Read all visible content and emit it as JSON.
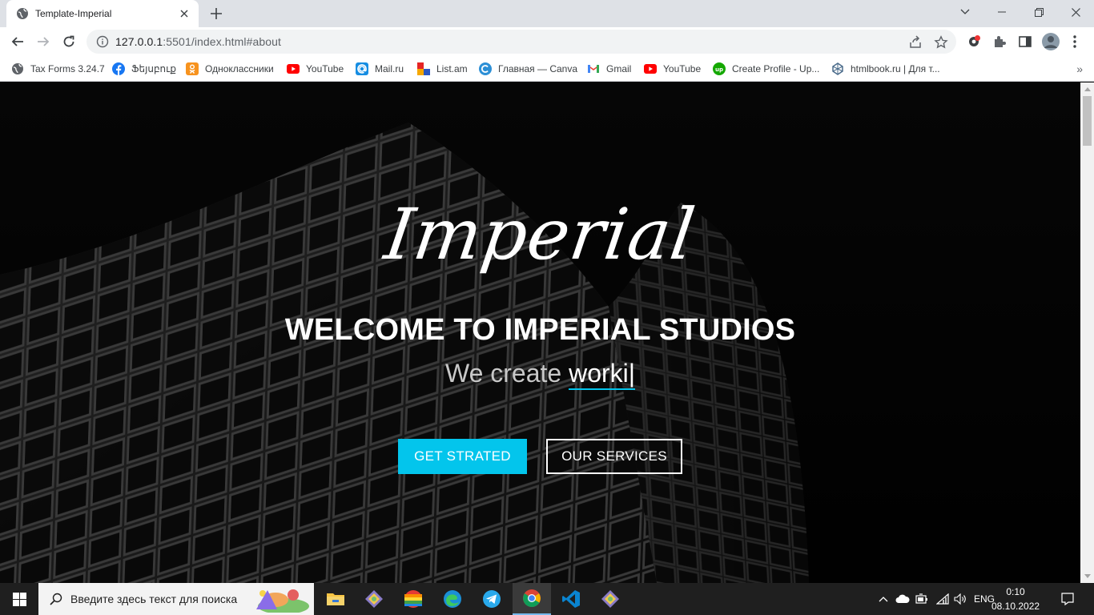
{
  "browser": {
    "tab": {
      "title": "Template-Imperial"
    },
    "address": {
      "host": "127.0.0.1",
      "rest": ":5501/index.html#about"
    },
    "bookmarks": [
      {
        "label": "Tax Forms 3.24.7",
        "icon": "globe-icon"
      },
      {
        "label": "Ֆեյսբուք",
        "icon": "facebook-icon"
      },
      {
        "label": "Одноклассники",
        "icon": "odnoklassniki-icon"
      },
      {
        "label": "YouTube",
        "icon": "youtube-icon"
      },
      {
        "label": "Mail.ru",
        "icon": "mailru-icon"
      },
      {
        "label": "List.am",
        "icon": "listam-icon"
      },
      {
        "label": "Главная — Canva",
        "icon": "canva-icon"
      },
      {
        "label": "Gmail",
        "icon": "gmail-icon"
      },
      {
        "label": "YouTube",
        "icon": "youtube-icon"
      },
      {
        "label": "Create Profile - Up...",
        "icon": "upwork-icon"
      },
      {
        "label": "htmlbook.ru | Для т...",
        "icon": "htmlbook-icon"
      }
    ],
    "more": "»"
  },
  "hero": {
    "logo": "Imperial",
    "heading": "WELCOME TO IMPERIAL STUDIOS",
    "tagline_static": "We create ",
    "tagline_typed": "worki",
    "cursor": "|",
    "primary_button": "GET STRATED",
    "secondary_button": "OUR SERVICES"
  },
  "taskbar": {
    "search_placeholder": "Введите здесь текст для поиска",
    "language": "ENG",
    "time": "0:10",
    "date": "08.10.2022"
  },
  "colors": {
    "accent": "#03c5ec",
    "taskbar": "#1f1f1f",
    "tabstrip": "#dee1e6"
  }
}
